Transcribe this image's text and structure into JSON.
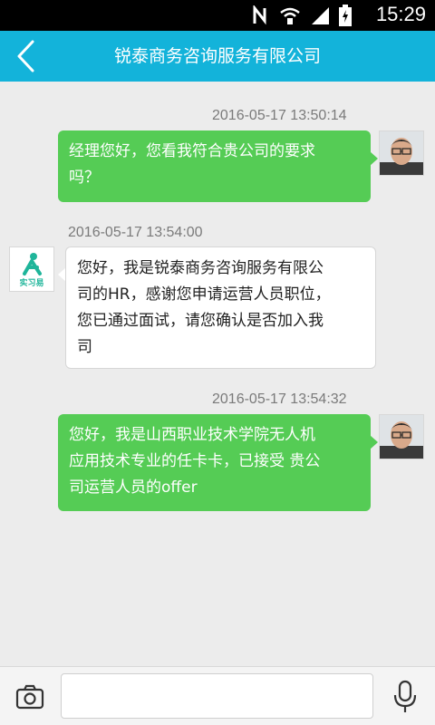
{
  "status_bar": {
    "time": "15:29",
    "icons": [
      "nfc-icon",
      "wifi-icon",
      "signal-icon",
      "battery-icon"
    ]
  },
  "header": {
    "title": "锐泰商务咨询服务有限公司",
    "back_icon": "chevron-left-icon"
  },
  "messages": [
    {
      "side": "right",
      "timestamp": "2016-05-17 13:50:14",
      "lines": [
        "经理您好，您看我符合贵公司的要求",
        "吗？"
      ],
      "avatar": "user-photo"
    },
    {
      "side": "left",
      "timestamp": "2016-05-17 13:54:00",
      "lines": [
        "您好，我是锐泰商务咨询服务有限公",
        "司的HR，感谢您申请运营人员职位，",
        "您已通过面试，请您确认是否加入我",
        "司"
      ],
      "avatar": "shixiyi-logo",
      "avatar_text": "实习易"
    },
    {
      "side": "right",
      "timestamp": "2016-05-17 13:54:32",
      "lines": [
        "您好，我是山西职业技术学院无人机",
        "应用技术专业的任卡卡，已接受 贵公",
        "司运营人员的offer"
      ],
      "avatar": "user-photo"
    }
  ],
  "input_bar": {
    "value": "",
    "camera_icon": "camera-icon",
    "mic_icon": "microphone-icon"
  },
  "colors": {
    "app_bar": "#13b3da",
    "sent_bubble": "#55cc55",
    "received_bubble": "#ffffff",
    "background": "#ececec"
  }
}
